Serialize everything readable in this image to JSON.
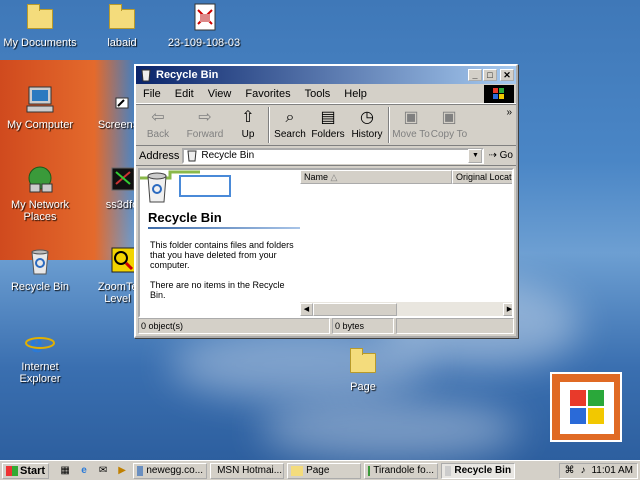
{
  "desktop": {
    "icons": [
      {
        "label": "My Documents",
        "icon": "folder-icon"
      },
      {
        "label": "labaid",
        "icon": "folder-icon"
      },
      {
        "label": "23-109-108-03",
        "icon": "document-icon"
      },
      {
        "label": "My Computer",
        "icon": "computer-icon"
      },
      {
        "label": "ScreenSa",
        "icon": "shortcut-icon"
      },
      {
        "label": "My Network Places",
        "icon": "network-icon"
      },
      {
        "label": "ss3dfo",
        "icon": "shortcut-icon"
      },
      {
        "label": "Recycle Bin",
        "icon": "recycle-bin-icon"
      },
      {
        "label": "ZoomText",
        "label2": "Level 2",
        "icon": "zoomtext-icon"
      },
      {
        "label": "Internet Explorer",
        "icon": "ie-icon"
      },
      {
        "label": "Page",
        "icon": "folder-icon"
      }
    ]
  },
  "window": {
    "title": "Recycle Bin",
    "menu": [
      "File",
      "Edit",
      "View",
      "Favorites",
      "Tools",
      "Help"
    ],
    "toolbar": [
      {
        "label": "Back",
        "enabled": false
      },
      {
        "label": "Forward",
        "enabled": false
      },
      {
        "label": "Up",
        "enabled": true
      },
      {
        "label": "Search",
        "enabled": true
      },
      {
        "label": "Folders",
        "enabled": true
      },
      {
        "label": "History",
        "enabled": true
      },
      {
        "label": "Move To",
        "enabled": false
      },
      {
        "label": "Copy To",
        "enabled": false
      }
    ],
    "address": {
      "label": "Address",
      "value": "Recycle Bin",
      "go": "Go"
    },
    "left_pane": {
      "heading": "Recycle Bin",
      "description": "This folder contains files and folders that you have deleted from your computer.",
      "empty_text": "There are no items in the Recycle Bin."
    },
    "columns": [
      "Name",
      "Original Location"
    ],
    "status": {
      "objects": "0 object(s)",
      "size": "0 bytes"
    }
  },
  "taskbar": {
    "start": "Start",
    "tasks": [
      {
        "label": "newegg.co...",
        "active": false
      },
      {
        "label": "MSN Hotmai...",
        "active": false
      },
      {
        "label": "Page",
        "active": false
      },
      {
        "label": "Tirandole fo...",
        "active": false
      },
      {
        "label": "Recycle Bin",
        "active": true
      }
    ],
    "clock": "11:01 AM"
  },
  "colors": {
    "desktop": "#3f78b8",
    "titlebar": "#0a246a",
    "taskbar": "#d4d0c8"
  }
}
